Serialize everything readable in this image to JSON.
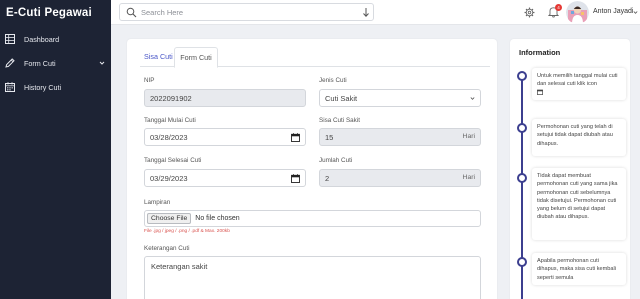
{
  "app": {
    "brand": "E-Cuti Pegawai"
  },
  "sidebar": {
    "items": [
      {
        "label": "Dashboard",
        "icon": "table-icon"
      },
      {
        "label": "Form Cuti",
        "icon": "pencil-icon",
        "expandable": true
      },
      {
        "label": "History Cuti",
        "icon": "calendar-icon"
      }
    ]
  },
  "topbar": {
    "search_placeholder": "Search Here",
    "notification_count": "4",
    "user_name": "Anton Jayadi"
  },
  "tabs": [
    {
      "label": "Sisa Cuti",
      "active": false
    },
    {
      "label": "Form Cuti",
      "active": true
    }
  ],
  "form": {
    "nip": {
      "label": "NIP",
      "value": "2022091902"
    },
    "jenis_cuti": {
      "label": "Jenis Cuti",
      "value": "Cuti Sakit"
    },
    "tanggal_mulai": {
      "label": "Tanggal Mulai Cuti",
      "value": "03/28/2023"
    },
    "sisa_cuti": {
      "label": "Sisa Cuti Sakit",
      "value": "15",
      "unit": "Hari"
    },
    "tanggal_selesai": {
      "label": "Tanggal Selesai Cuti",
      "value": "03/29/2023"
    },
    "jumlah_cuti": {
      "label": "Jumlah Cuti",
      "value": "2",
      "unit": "Hari"
    },
    "lampiran": {
      "label": "Lampiran",
      "button": "Choose File",
      "file_name": "No file chosen",
      "hint": "File .jpg / jpeg / .png / .pdf & Max. 200kb"
    },
    "keterangan": {
      "label": "Keterangan Cuti",
      "value": "Keterangan sakit"
    }
  },
  "info": {
    "title": "Information",
    "items": [
      "Untuk memilih tanggal mulai cuti dan selesai cuti klik icon",
      "Permohonan cuti yang telah di setujui tidak dapat diubah atau dihapus.",
      "Tidak dapat membuat permohonan cuti yang sama jika permohonan cuti sebelumnya tidak disetujui. Permohonan cuti yang belum di setujui dapat diubah atau dihapus.",
      "Apabila permohonan cuti dihapus, maka sisa cuti kembali seperti semula"
    ]
  },
  "colors": {
    "sidebar_bg": "#1d2334",
    "accent": "#3c3f8f",
    "tab_active_text": "#4a57c8",
    "badge": "#e53935"
  }
}
